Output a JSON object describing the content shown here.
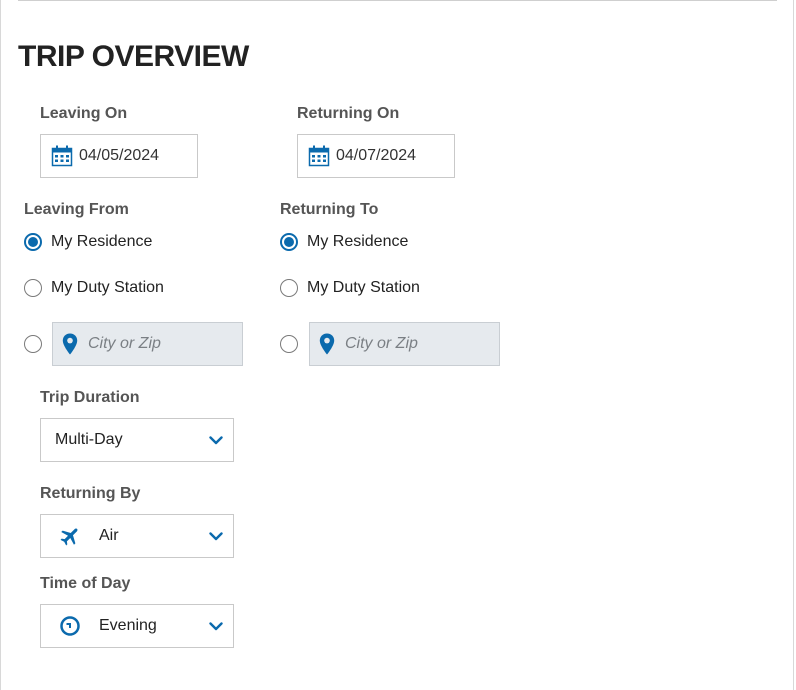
{
  "header": {
    "title": "TRIP OVERVIEW"
  },
  "leaving_on": {
    "label": "Leaving On",
    "date": "04/05/2024",
    "icon": "calendar-icon"
  },
  "returning_on": {
    "label": "Returning On",
    "date": "04/07/2024",
    "icon": "calendar-icon"
  },
  "leaving_from": {
    "label": "Leaving From",
    "options": [
      "My Residence",
      "My Duty Station"
    ],
    "selected": "My Residence",
    "custom_placeholder": "City or Zip"
  },
  "returning_to": {
    "label": "Returning To",
    "options": [
      "My Residence",
      "My Duty Station"
    ],
    "selected": "My Residence",
    "custom_placeholder": "City or Zip"
  },
  "trip_duration": {
    "label": "Trip Duration",
    "value": "Multi-Day"
  },
  "returning_by": {
    "label": "Returning By",
    "value": "Air",
    "icon": "airplane-icon"
  },
  "time_of_day": {
    "label": "Time of Day",
    "value": "Evening",
    "icon": "clock-icon"
  },
  "colors": {
    "accent": "#0b6aad",
    "field_disabled_bg": "#e6eaee",
    "border": "#c9c9c9"
  }
}
